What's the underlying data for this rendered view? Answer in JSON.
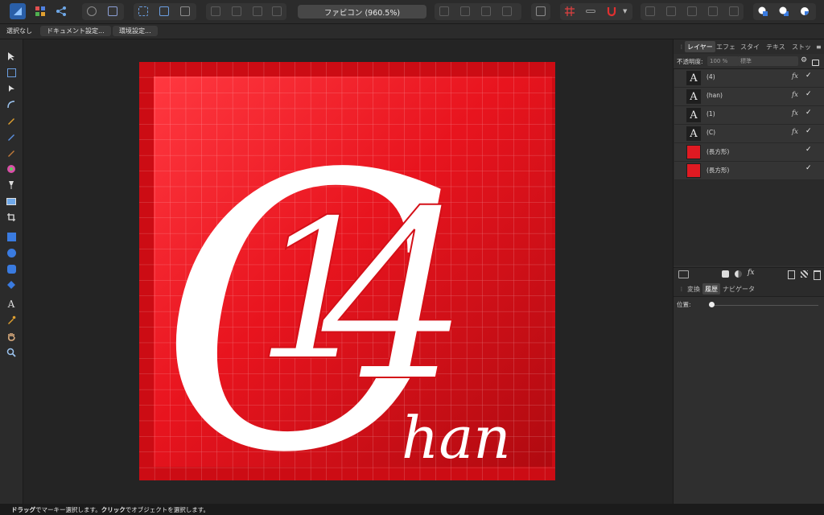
{
  "toolbar": {
    "document_title": "ファビコン (960.5%)"
  },
  "context": {
    "no_selection": "選択なし",
    "document_setup": "ドキュメント設定...",
    "preferences": "環境設定..."
  },
  "panel": {
    "tabs": [
      "レイヤー",
      "エフェ",
      "スタイ",
      "テキス",
      "ストッ"
    ],
    "opacity_label": "不透明度:",
    "opacity_value": "100 %",
    "blend_mode": "標準",
    "layers": [
      {
        "name": "(4)",
        "kind": "text",
        "thumb": "A",
        "fx": "fx",
        "visible": "✓"
      },
      {
        "name": "(han)",
        "kind": "text",
        "thumb": "A",
        "fx": "fx",
        "visible": "✓"
      },
      {
        "name": "(1)",
        "kind": "text",
        "thumb": "A",
        "fx": "fx",
        "visible": "✓"
      },
      {
        "name": "(C)",
        "kind": "text",
        "thumb": "A",
        "fx": "fx",
        "visible": "✓"
      },
      {
        "name": "(長方形)",
        "kind": "rect",
        "thumb": "",
        "fx": "",
        "visible": "✓"
      },
      {
        "name": "(長方形)",
        "kind": "rect",
        "thumb": "",
        "fx": "",
        "visible": "✓"
      }
    ],
    "bottom_tabs": [
      "変換",
      "履歴",
      "ナビゲータ"
    ],
    "position_label": "位置:"
  },
  "artwork": {
    "big_letter": "C",
    "digit_one": "1",
    "digit_four": "4",
    "word": "han",
    "bg_color": "#e8141e",
    "dark_color": "#b80c12"
  },
  "status": {
    "drag": "ドラッグ",
    "drag_text": "でマーキー選択します。",
    "click": "クリック",
    "click_text": "でオブジェクトを選択します。"
  }
}
